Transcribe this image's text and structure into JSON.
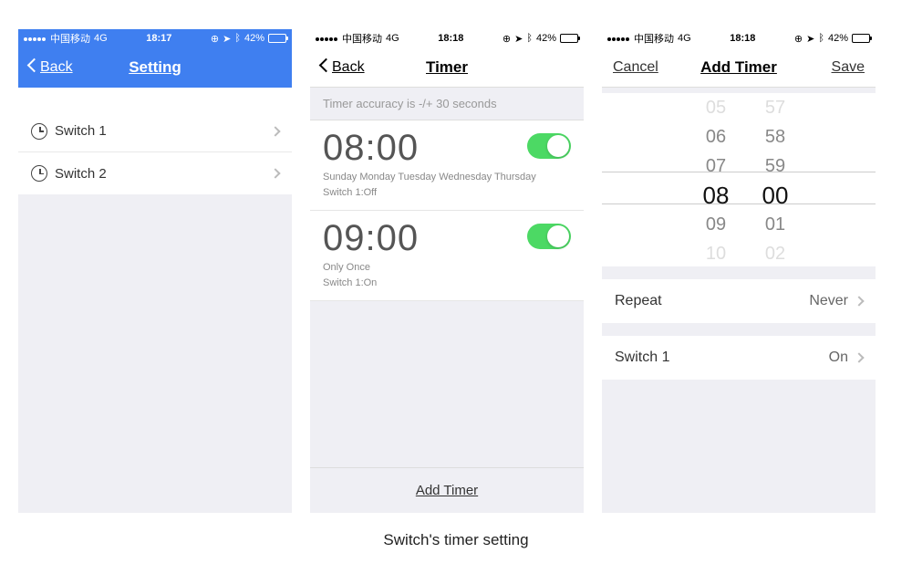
{
  "status": {
    "carrier": "中国移动",
    "network": "4G",
    "battery": "42%"
  },
  "screen1": {
    "time": "18:17",
    "back": "Back",
    "title": "Setting",
    "items": [
      {
        "label": "Switch 1"
      },
      {
        "label": "Switch 2"
      }
    ]
  },
  "screen2": {
    "time": "18:18",
    "back": "Back",
    "title": "Timer",
    "notice": "Timer accuracy is -/+ 30 seconds",
    "timers": [
      {
        "time": "08:00",
        "days": "Sunday Monday Tuesday Wednesday Thursday",
        "action": "Switch 1:Off",
        "enabled": true
      },
      {
        "time": "09:00",
        "days": "Only Once",
        "action": "Switch 1:On",
        "enabled": true
      }
    ],
    "addTimer": "Add Timer"
  },
  "screen3": {
    "time": "18:18",
    "cancel": "Cancel",
    "title": "Add Timer",
    "save": "Save",
    "picker": {
      "hours": [
        "05",
        "06",
        "07",
        "08",
        "09",
        "10"
      ],
      "mins": [
        "57",
        "58",
        "59",
        "00",
        "01",
        "02"
      ],
      "selectedHour": "08",
      "selectedMin": "00"
    },
    "rows": [
      {
        "label": "Repeat",
        "value": "Never"
      },
      {
        "label": "Switch 1",
        "value": "On"
      }
    ]
  },
  "caption": "Switch's timer setting"
}
